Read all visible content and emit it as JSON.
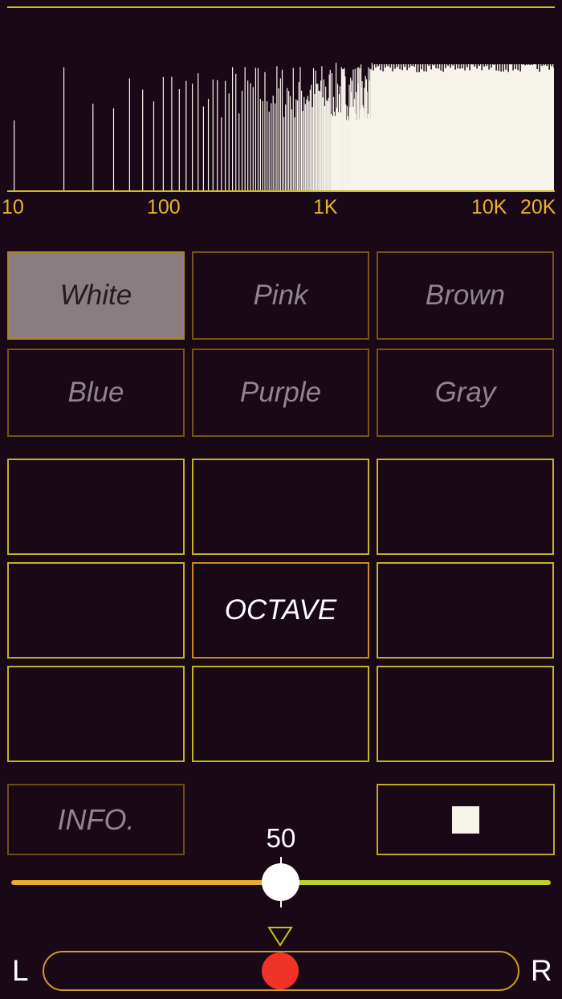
{
  "spectrum": {
    "axis_labels": [
      "10",
      "100",
      "1K",
      "10K",
      "20K"
    ],
    "line_color": "#f6f4ea",
    "axis_color": "#c9c01c",
    "label_color": "#e9b32a"
  },
  "noise_types": [
    {
      "label": "White",
      "selected": true
    },
    {
      "label": "Pink",
      "selected": false
    },
    {
      "label": "Brown",
      "selected": false
    },
    {
      "label": "Blue",
      "selected": false
    },
    {
      "label": "Purple",
      "selected": false
    },
    {
      "label": "Gray",
      "selected": false
    }
  ],
  "band_grid": {
    "center_label": "OCTAVE"
  },
  "controls": {
    "info_label": "INFO.",
    "stop_icon": "stop-square-icon"
  },
  "volume": {
    "value": "50",
    "level": 0.5,
    "left_color": "#e7ad2b",
    "right_color": "#bfd324"
  },
  "balance": {
    "left_label": "L",
    "right_label": "R",
    "position": 0.5,
    "indicator_color": "#ef3328"
  }
}
